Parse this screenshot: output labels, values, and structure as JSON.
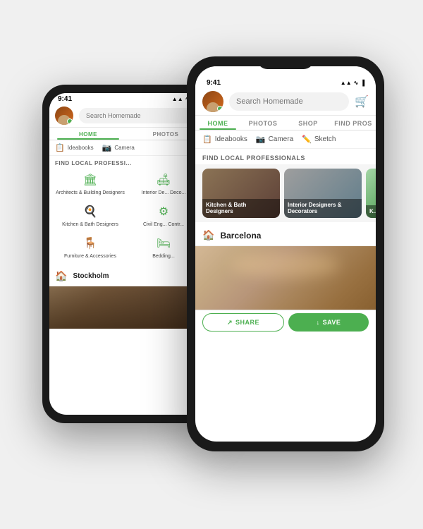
{
  "app": {
    "name": "Homemade",
    "search_placeholder": "Search Homemade"
  },
  "back_phone": {
    "status": {
      "time": "9:41",
      "signal": "▲▲▲",
      "wifi": "WiFi",
      "battery": "🔋"
    },
    "nav_tabs": [
      {
        "label": "HOME",
        "active": true
      },
      {
        "label": "PHOTOS",
        "active": false
      }
    ],
    "quick_actions": [
      {
        "label": "Ideabooks",
        "icon": "📋"
      },
      {
        "label": "Camera",
        "icon": "📷"
      }
    ],
    "section_title": "FIND LOCAL PROFESSI...",
    "categories": [
      {
        "label": "Architects & Building Designers",
        "icon": "🏛"
      },
      {
        "label": "Interior De... Deco...",
        "icon": "🛋"
      },
      {
        "label": "Kitchen & Bath Designers",
        "icon": "🍳"
      },
      {
        "label": "Civil Eng... Contr...",
        "icon": "⚙"
      },
      {
        "label": "Furniture & Accessories",
        "icon": "🪑"
      },
      {
        "label": "Bedding...",
        "icon": "🛏"
      }
    ],
    "city": "Stockholm"
  },
  "front_phone": {
    "status": {
      "time": "9:41",
      "signal": "▲▲▲",
      "wifi": "WiFi",
      "battery": "🔋"
    },
    "nav_tabs": [
      {
        "label": "HOME",
        "active": true
      },
      {
        "label": "PHOTOS",
        "active": false
      },
      {
        "label": "SHOP",
        "active": false
      },
      {
        "label": "FIND PROS",
        "active": false
      }
    ],
    "quick_actions": [
      {
        "label": "Ideabooks",
        "icon": "📋"
      },
      {
        "label": "Camera",
        "icon": "📷"
      },
      {
        "label": "Sketch",
        "icon": "✏"
      }
    ],
    "section_title": "FIND LOCAL PROFESSIONALS",
    "pro_cards": [
      {
        "label": "Kitchen & Bath\nDesigners",
        "bg": "pro-card-1"
      },
      {
        "label": "Interior Designers &\nDecorators",
        "bg": "pro-card-2"
      },
      {
        "label": "K...",
        "bg": "pro-card-3"
      }
    ],
    "city": "Barcelona",
    "bottom_bar": {
      "share_label": "SHARE",
      "save_label": "SAVE"
    }
  }
}
